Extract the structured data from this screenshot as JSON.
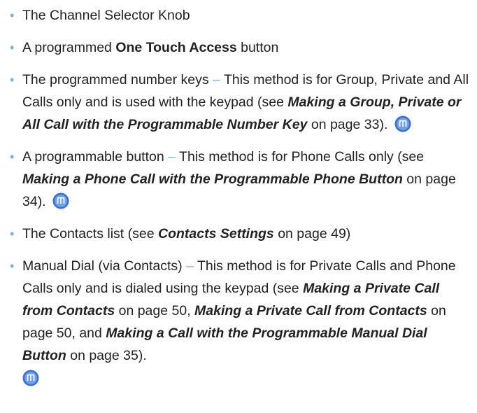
{
  "colors": {
    "bullet": "#7fb0d8",
    "text": "#222222",
    "icon_outer": "#3a6fd0",
    "icon_inner": "#bcd7ff"
  },
  "items": [
    {
      "t1": "The Channel Selector Knob"
    },
    {
      "t1": "A programmed ",
      "b1": "One Touch Access",
      "t2": " button"
    },
    {
      "t1": "The programmed number keys ",
      "dash": "–",
      "t2": " This method is for Group, Private and All Calls only and is used with the keypad (see ",
      "bi1": "Making a Group, Private or All Call with the Programmable Number Key",
      "t3": " on page 33).",
      "icon": "radio-mode-icon"
    },
    {
      "t1": "A programmable button ",
      "dash": "–",
      "t2": " This method is for Phone Calls only (see ",
      "bi1": "Making a Phone Call with the Programmable Phone Button",
      "t3": " on page 34).",
      "icon": "radio-mode-icon"
    },
    {
      "t1": "The Contacts list (see ",
      "bi1": "Contacts Settings",
      "t2": " on page 49)"
    },
    {
      "t1": "Manual Dial (via Contacts) ",
      "dash": "–",
      "t2": " This method is for Private Calls and Phone Calls only and is dialed using the keypad (see ",
      "bi1": "Making a Private Call from Contacts",
      "t3": " on page 50, ",
      "bi2": "Making a Private Call from Contacts",
      "t4": " on page 50, and ",
      "bi3": "Making a Call with the Programmable Manual Dial Button",
      "t5": " on page 35).",
      "icon": "radio-mode-icon"
    }
  ]
}
